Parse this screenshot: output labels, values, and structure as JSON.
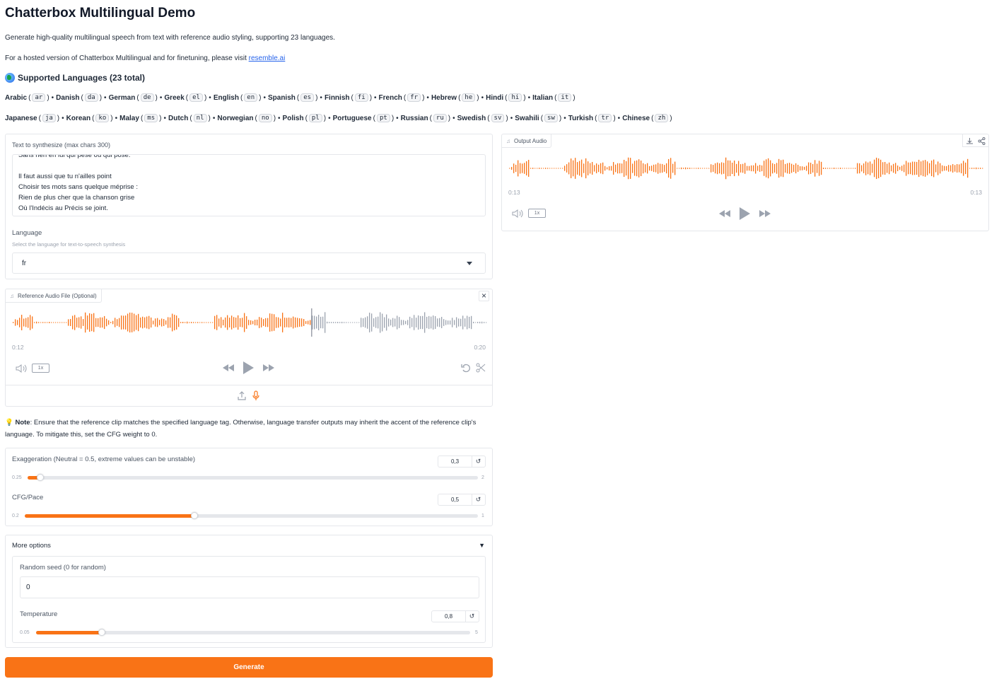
{
  "title": "Chatterbox Multilingual Demo",
  "intro": "Generate high-quality multilingual speech from text with reference audio styling, supporting 23 languages.",
  "hosted_prefix": "For a hosted version of Chatterbox Multilingual and for finetuning, please visit ",
  "hosted_link": "resemble.ai",
  "languages_heading": "Supported Languages (23 total)",
  "languages_row1": [
    {
      "name": "Arabic",
      "code": "ar"
    },
    {
      "name": "Danish",
      "code": "da"
    },
    {
      "name": "German",
      "code": "de"
    },
    {
      "name": "Greek",
      "code": "el"
    },
    {
      "name": "English",
      "code": "en"
    },
    {
      "name": "Spanish",
      "code": "es"
    },
    {
      "name": "Finnish",
      "code": "fi"
    },
    {
      "name": "French",
      "code": "fr"
    },
    {
      "name": "Hebrew",
      "code": "he"
    },
    {
      "name": "Hindi",
      "code": "hi"
    },
    {
      "name": "Italian",
      "code": "it"
    }
  ],
  "languages_row2": [
    {
      "name": "Japanese",
      "code": "ja"
    },
    {
      "name": "Korean",
      "code": "ko"
    },
    {
      "name": "Malay",
      "code": "ms"
    },
    {
      "name": "Dutch",
      "code": "nl"
    },
    {
      "name": "Norwegian",
      "code": "no"
    },
    {
      "name": "Polish",
      "code": "pl"
    },
    {
      "name": "Portuguese",
      "code": "pt"
    },
    {
      "name": "Russian",
      "code": "ru"
    },
    {
      "name": "Swedish",
      "code": "sv"
    },
    {
      "name": "Swahili",
      "code": "sw"
    },
    {
      "name": "Turkish",
      "code": "tr"
    },
    {
      "name": "Chinese",
      "code": "zh"
    }
  ],
  "text_panel": {
    "label": "Text to synthesize (max chars 300)",
    "lines": [
      "Sans rien en lui qui pèse ou qui pose.",
      "",
      "Il faut aussi que tu n'ailles point",
      "Choisir tes mots sans quelque méprise :",
      "Rien de plus cher que la chanson grise",
      "Où l'Indécis au Précis se joint."
    ],
    "language_label": "Language",
    "language_info": "Select the language for text-to-speech synthesis",
    "language_value": "fr"
  },
  "reference_audio": {
    "label": "Reference Audio File (Optional)",
    "time_current": "0:12",
    "time_total": "0:20",
    "speed": "1x",
    "progress": 0.63
  },
  "output_audio": {
    "label": "Output Audio",
    "time_current": "0:13",
    "time_total": "0:13",
    "speed": "1x",
    "progress": 1.0
  },
  "note": {
    "bold": "Note",
    "text": ": Ensure that the reference clip matches the specified language tag. Otherwise, language transfer outputs may inherit the accent of the reference clip's language. To mitigate this, set the CFG weight to 0."
  },
  "exaggeration": {
    "label": "Exaggeration (Neutral = 0.5, extreme values can be unstable)",
    "value": "0,3",
    "min": "0.25",
    "max": "2",
    "fraction": 0.029
  },
  "cfg": {
    "label": "CFG/Pace",
    "value": "0,5",
    "min": "0.2",
    "max": "1",
    "fraction": 0.375
  },
  "more_options": {
    "label": "More options",
    "seed_label": "Random seed (0 for random)",
    "seed_value": "0",
    "temperature": {
      "label": "Temperature",
      "value": "0,8",
      "min": "0.05",
      "max": "5",
      "fraction": 0.152
    }
  },
  "generate_label": "Generate",
  "colors": {
    "accent": "#f97316",
    "wave_played": "#f97316",
    "wave_unplayed": "#9ca3af"
  }
}
